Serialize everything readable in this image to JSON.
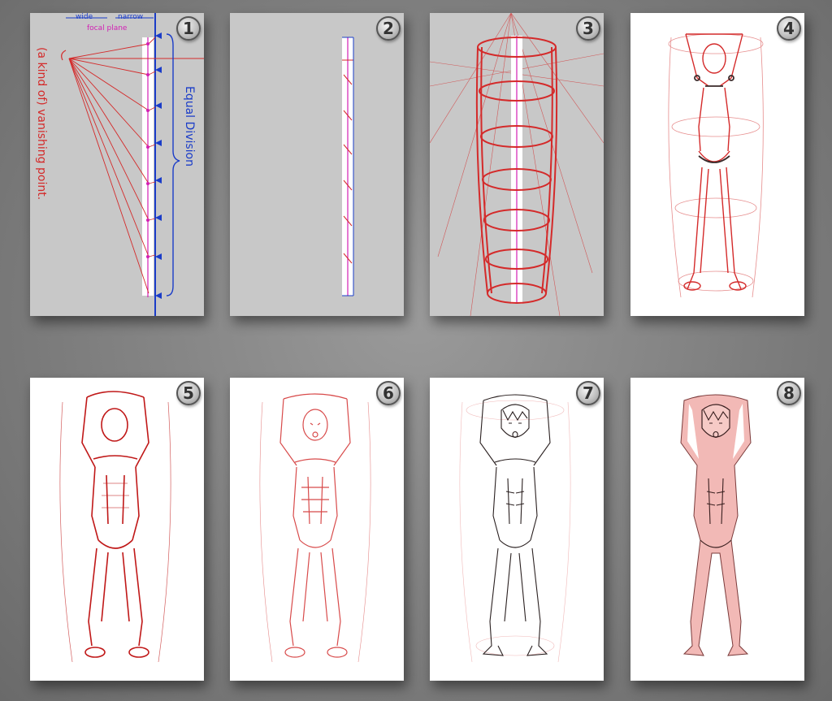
{
  "panels": [
    {
      "number": "1"
    },
    {
      "number": "2"
    },
    {
      "number": "3"
    },
    {
      "number": "4"
    },
    {
      "number": "5"
    },
    {
      "number": "6"
    },
    {
      "number": "7"
    },
    {
      "number": "8"
    }
  ],
  "annotations": {
    "wide": "wide",
    "narrow": "narrow",
    "focal_plane": "focal plane",
    "equal_division": "Equal Division",
    "vanishing_point": "(a kind of) vanishing point."
  },
  "colors": {
    "sketch_red": "#d42a2a",
    "guide_blue": "#1a3cc8",
    "guide_magenta": "#d21fb4",
    "skin_tone": "#f2b9b6",
    "ink": "#3a2a2a"
  }
}
